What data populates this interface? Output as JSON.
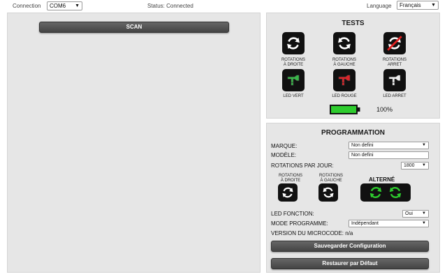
{
  "topbar": {
    "connection_label": "Connection",
    "connection_value": "COM6",
    "status_text": "Status: Connected",
    "language_label": "Language",
    "language_value": "Français"
  },
  "left": {
    "scan_label": "SCAN"
  },
  "tests": {
    "title": "TESTS",
    "items": [
      {
        "label1": "ROTATIONS",
        "label2": "À DROITE",
        "icon": "rotate-right-icon"
      },
      {
        "label1": "ROTATIONS",
        "label2": "À GAUCHE",
        "icon": "rotate-left-icon"
      },
      {
        "label1": "ROTATIONS",
        "label2": "ARRET",
        "icon": "rotation-stop-icon"
      },
      {
        "label1": "LED VERT",
        "label2": "",
        "icon": "led-green-icon",
        "color": "#3ab54a"
      },
      {
        "label1": "LED ROUGE",
        "label2": "",
        "icon": "led-red-icon",
        "color": "#d8262b"
      },
      {
        "label1": "LED ARRET",
        "label2": "",
        "icon": "led-off-icon",
        "color": "#eeeeee"
      }
    ],
    "battery_level": 1.0,
    "battery_text": "100%",
    "battery_color": "#2ecc2e"
  },
  "prog": {
    "title": "PROGRAMMATION",
    "brand_label": "MARQUE:",
    "brand_value": "Non defini",
    "model_label": "MODÈLE:",
    "model_value": "Non defini",
    "rpd_label": "ROTATIONS PAR JOUR:",
    "rpd_value": "1800",
    "dir_right_1": "ROTATIONS",
    "dir_right_2": "À DROITE",
    "dir_left_1": "ROTATIONS",
    "dir_left_2": "À GAUCHE",
    "alternate_label": "ALTERNÉ",
    "alternate_color": "#2ecc2e",
    "led_label": "LED FONCTION:",
    "led_value": "Oui",
    "mode_label": "MODE PROGRAMME:",
    "mode_value": "Indépendant",
    "version_label": "VERSION DU MICROCODE: n/a",
    "save_label": "Sauvegarder  Configuration",
    "restore_label": "Restaurer par Défaut"
  }
}
